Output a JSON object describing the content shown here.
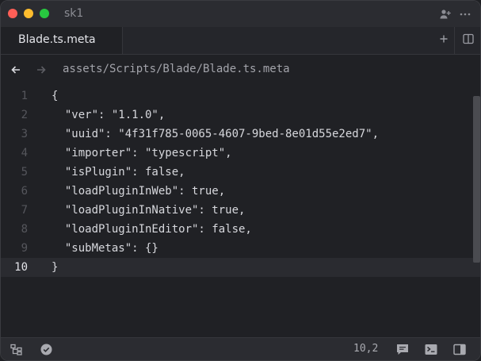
{
  "window": {
    "title": "sk1"
  },
  "icons": {
    "close": "close-dot",
    "minimize": "minimize-dot",
    "maximize": "maximize-dot",
    "collaborators": "person-plus-icon",
    "more": "more-horizontal-icon",
    "new_tab": "plus-icon",
    "split": "split-view-icon",
    "back": "arrow-left-icon",
    "forward": "arrow-right-icon",
    "file_tree": "file-tree-icon",
    "diagnostics": "check-circle-icon",
    "comments": "comment-icon",
    "terminal": "terminal-icon",
    "panel": "panel-right-icon"
  },
  "colors": {
    "close": "#ff5f57",
    "minimize": "#febc2e",
    "maximize": "#28c840",
    "background": "#202125"
  },
  "tabs": [
    {
      "label": "Blade.ts.meta",
      "active": true
    }
  ],
  "breadcrumb": {
    "path": "assets/Scripts/Blade/Blade.ts.meta"
  },
  "editor": {
    "current_line": 10,
    "lines": [
      {
        "num": "1",
        "text": "{"
      },
      {
        "num": "2",
        "text": "  \"ver\": \"1.1.0\","
      },
      {
        "num": "3",
        "text": "  \"uuid\": \"4f31f785-0065-4607-9bed-8e01d55e2ed7\","
      },
      {
        "num": "4",
        "text": "  \"importer\": \"typescript\","
      },
      {
        "num": "5",
        "text": "  \"isPlugin\": false,"
      },
      {
        "num": "6",
        "text": "  \"loadPluginInWeb\": true,"
      },
      {
        "num": "7",
        "text": "  \"loadPluginInNative\": true,"
      },
      {
        "num": "8",
        "text": "  \"loadPluginInEditor\": false,"
      },
      {
        "num": "9",
        "text": "  \"subMetas\": {}"
      },
      {
        "num": "10",
        "text": "}"
      }
    ]
  },
  "status": {
    "cursor": "10,2"
  }
}
